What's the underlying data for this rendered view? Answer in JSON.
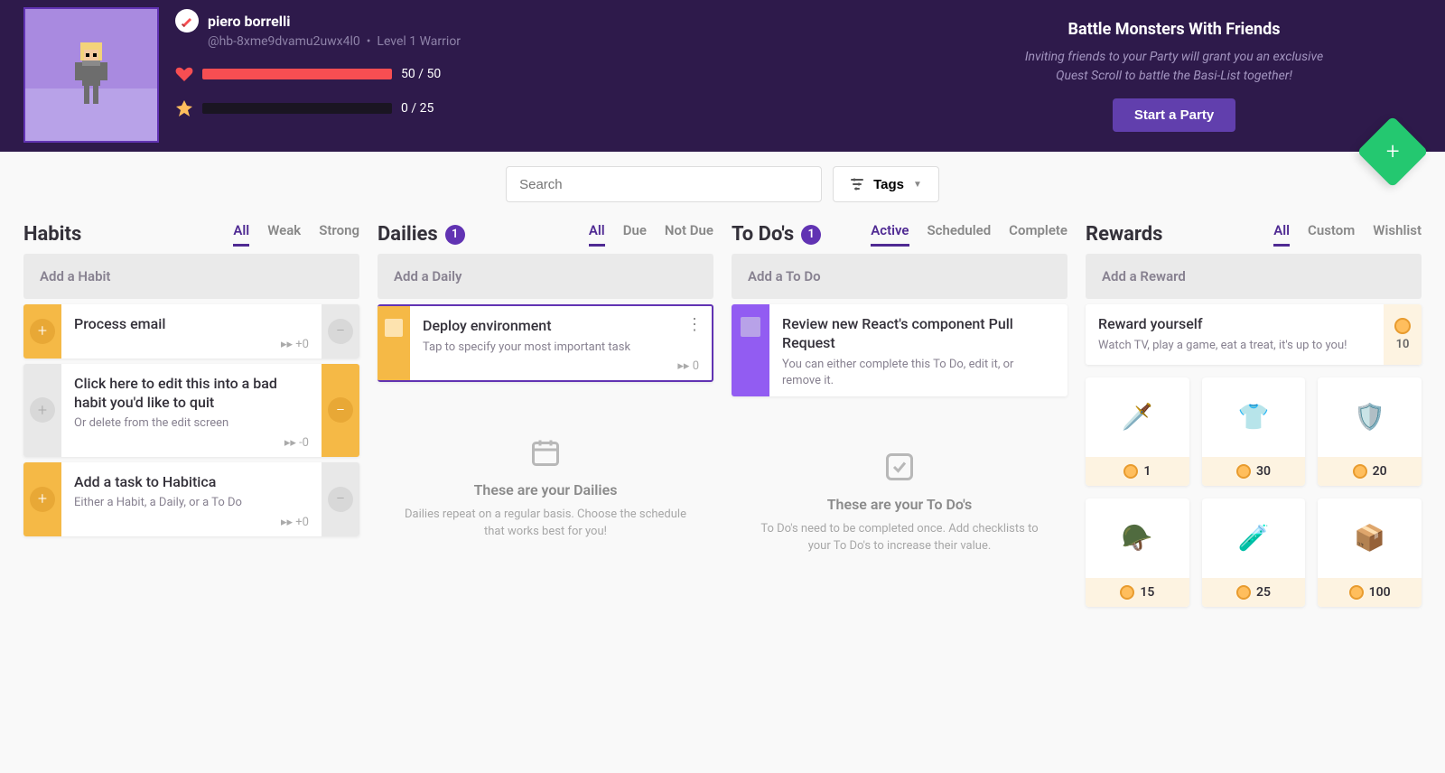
{
  "user": {
    "name": "piero borrelli",
    "handle": "@hb-8xme9dvamu2uwx4l0",
    "level": "Level 1 Warrior"
  },
  "stats": {
    "health_text": "50 / 50",
    "health_pct": 100,
    "health_color": "#f74e52",
    "exp_text": "0 / 25",
    "exp_pct": 0,
    "exp_color": "#ffbe5d"
  },
  "promo": {
    "title": "Battle Monsters With Friends",
    "line1": "Inviting friends to your Party will grant you an exclusive",
    "line2": "Quest Scroll to battle the Basi-List together!",
    "button": "Start a Party"
  },
  "toolbar": {
    "search_placeholder": "Search",
    "tags_label": "Tags"
  },
  "habits": {
    "title": "Habits",
    "tabs": [
      "All",
      "Weak",
      "Strong"
    ],
    "add": "Add a Habit",
    "items": [
      {
        "title": "Process email",
        "sub": "",
        "streak": "+0",
        "pos_bg": "#f5b946",
        "neg_bg": "#e8e8e8",
        "pos_active": true
      },
      {
        "title": "Click here to edit this into a bad habit you'd like to quit",
        "sub": "Or delete from the edit screen",
        "streak": "-0",
        "pos_bg": "#e8e8e8",
        "neg_bg": "#f5b946",
        "pos_active": false
      },
      {
        "title": "Add a task to Habitica",
        "sub": "Either a Habit, a Daily, or a To Do",
        "streak": "+0",
        "pos_bg": "#f5b946",
        "neg_bg": "#e8e8e8",
        "pos_active": true
      }
    ]
  },
  "dailies": {
    "title": "Dailies",
    "badge": "1",
    "tabs": [
      "All",
      "Due",
      "Not Due"
    ],
    "add": "Add a Daily",
    "item": {
      "title": "Deploy environment",
      "sub": "Tap to specify your most important task",
      "streak": "0"
    },
    "empty_title": "These are your Dailies",
    "empty_sub": "Dailies repeat on a regular basis. Choose the schedule that works best for you!"
  },
  "todos": {
    "title": "To Do's",
    "badge": "1",
    "tabs": [
      "Active",
      "Scheduled",
      "Complete"
    ],
    "add": "Add a To Do",
    "item": {
      "title": "Review new React's component Pull Request",
      "sub": "You can either complete this To Do, edit it, or remove it."
    },
    "empty_title": "These are your To Do's",
    "empty_sub": "To Do's need to be completed once. Add checklists to your To Do's to increase their value."
  },
  "rewards": {
    "title": "Rewards",
    "tabs": [
      "All",
      "Custom",
      "Wishlist"
    ],
    "add": "Add a Reward",
    "default": {
      "title": "Reward yourself",
      "sub": "Watch TV, play a game, eat a treat, it's up to you!",
      "cost": "10"
    },
    "shop": [
      {
        "icon": "sword",
        "glyph": "🗡️",
        "price": "1"
      },
      {
        "icon": "armor",
        "glyph": "👕",
        "price": "30"
      },
      {
        "icon": "shield",
        "glyph": "🛡️",
        "price": "20"
      },
      {
        "icon": "helmet",
        "glyph": "🪖",
        "price": "15"
      },
      {
        "icon": "potion",
        "glyph": "🧪",
        "price": "25"
      },
      {
        "icon": "chest",
        "glyph": "📦",
        "price": "100"
      }
    ]
  }
}
